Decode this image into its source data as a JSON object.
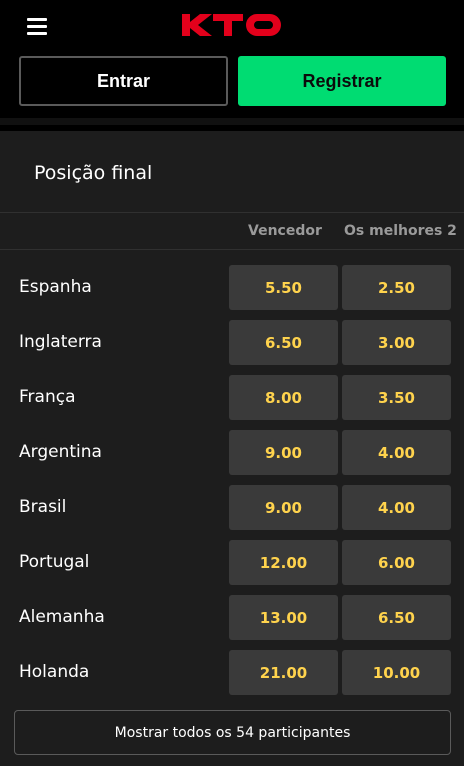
{
  "header": {
    "logo_text": "KTO",
    "menu_icon": "hamburger-menu-icon",
    "login_label": "Entrar",
    "register_label": "Registrar",
    "colors": {
      "brand_red": "#e3001b",
      "register_green": "#00dc72",
      "odd_yellow": "#ffd34d"
    }
  },
  "market": {
    "title": "Posição final",
    "columns": [
      "Vencedor",
      "Os melhores 2"
    ],
    "rows": [
      {
        "name": "Espanha",
        "odds": [
          "5.50",
          "2.50"
        ]
      },
      {
        "name": "Inglaterra",
        "odds": [
          "6.50",
          "3.00"
        ]
      },
      {
        "name": "França",
        "odds": [
          "8.00",
          "3.50"
        ]
      },
      {
        "name": "Argentina",
        "odds": [
          "9.00",
          "4.00"
        ]
      },
      {
        "name": "Brasil",
        "odds": [
          "9.00",
          "4.00"
        ]
      },
      {
        "name": "Portugal",
        "odds": [
          "12.00",
          "6.00"
        ]
      },
      {
        "name": "Alemanha",
        "odds": [
          "13.00",
          "6.50"
        ]
      },
      {
        "name": "Holanda",
        "odds": [
          "21.00",
          "10.00"
        ]
      }
    ],
    "show_all_label": "Mostrar todos os 54 participantes"
  }
}
